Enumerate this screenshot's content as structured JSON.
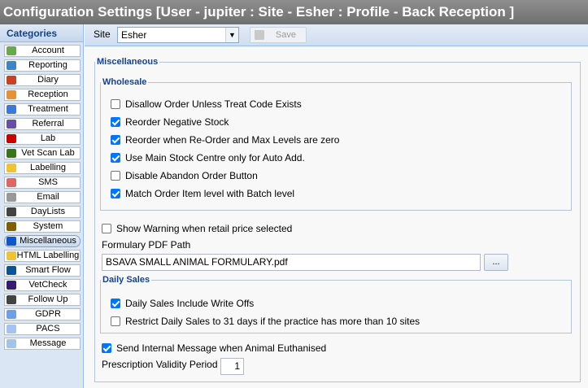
{
  "window": {
    "title": "Configuration Settings [User - jupiter : Site - Esher : Profile - Back Reception ]"
  },
  "sidebar": {
    "header": "Categories",
    "items": [
      {
        "label": "Account",
        "icon": "account-icon",
        "color": "#6aa84f"
      },
      {
        "label": "Reporting",
        "icon": "reporting-icon",
        "color": "#3d85c6"
      },
      {
        "label": "Diary",
        "icon": "diary-icon",
        "color": "#cc4125"
      },
      {
        "label": "Reception",
        "icon": "reception-icon",
        "color": "#e69138"
      },
      {
        "label": "Treatment",
        "icon": "treatment-icon",
        "color": "#3c78d8"
      },
      {
        "label": "Referral",
        "icon": "referral-icon",
        "color": "#674ea7"
      },
      {
        "label": "Lab",
        "icon": "lab-icon",
        "color": "#cc0000"
      },
      {
        "label": "Vet Scan Lab",
        "icon": "vet-scan-lab-icon",
        "color": "#38761d"
      },
      {
        "label": "Labelling",
        "icon": "labelling-icon",
        "color": "#f1c232"
      },
      {
        "label": "SMS",
        "icon": "sms-icon",
        "color": "#e06666"
      },
      {
        "label": "Email",
        "icon": "email-icon",
        "color": "#999999"
      },
      {
        "label": "DayLists",
        "icon": "daylists-icon",
        "color": "#434343"
      },
      {
        "label": "System",
        "icon": "system-icon",
        "color": "#7f6000"
      },
      {
        "label": "Miscellaneous",
        "icon": "miscellaneous-icon",
        "color": "#1155cc"
      },
      {
        "label": "HTML Labelling",
        "icon": "html-labelling-icon",
        "color": "#f1c232"
      },
      {
        "label": "Smart Flow",
        "icon": "smart-flow-icon",
        "color": "#0b5394"
      },
      {
        "label": "VetCheck",
        "icon": "vetcheck-icon",
        "color": "#351c75"
      },
      {
        "label": "Follow Up",
        "icon": "follow-up-icon",
        "color": "#434343"
      },
      {
        "label": "GDPR",
        "icon": "gdpr-icon",
        "color": "#6d9eeb"
      },
      {
        "label": "PACS",
        "icon": "pacs-icon",
        "color": "#a4c2f4"
      },
      {
        "label": "Message",
        "icon": "message-icon",
        "color": "#9fc5e8"
      }
    ],
    "selected": "Miscellaneous"
  },
  "toolbar": {
    "site_label": "Site",
    "site_value": "Esher",
    "save_label": "Save"
  },
  "misc": {
    "legend": "Miscellaneous",
    "wholesale": {
      "legend": "Wholesale",
      "options": [
        {
          "label": "Disallow Order Unless Treat Code Exists",
          "checked": false
        },
        {
          "label": "Reorder Negative Stock",
          "checked": true
        },
        {
          "label": "Reorder when Re-Order and Max Levels are zero",
          "checked": true
        },
        {
          "label": "Use Main Stock Centre only for Auto Add.",
          "checked": true
        },
        {
          "label": "Disable Abandon Order Button",
          "checked": false
        },
        {
          "label": "Match Order Item level with Batch level",
          "checked": true
        }
      ]
    },
    "show_warning": {
      "label": "Show Warning when retail price selected",
      "checked": false
    },
    "formulary": {
      "label": "Formulary PDF Path",
      "value": "BSAVA SMALL ANIMAL FORMULARY.pdf",
      "browse_label": "..."
    },
    "daily_sales": {
      "legend": "Daily Sales",
      "options": [
        {
          "label": "Daily Sales Include Write Offs",
          "checked": true
        },
        {
          "label": "Restrict Daily Sales to 31 days if the practice has more than 10 sites",
          "checked": false
        }
      ]
    },
    "euthanised": {
      "label": "Send Internal Message when Animal Euthanised",
      "checked": true
    },
    "prescription": {
      "label": "Prescription Validity Period",
      "value": "1"
    }
  }
}
